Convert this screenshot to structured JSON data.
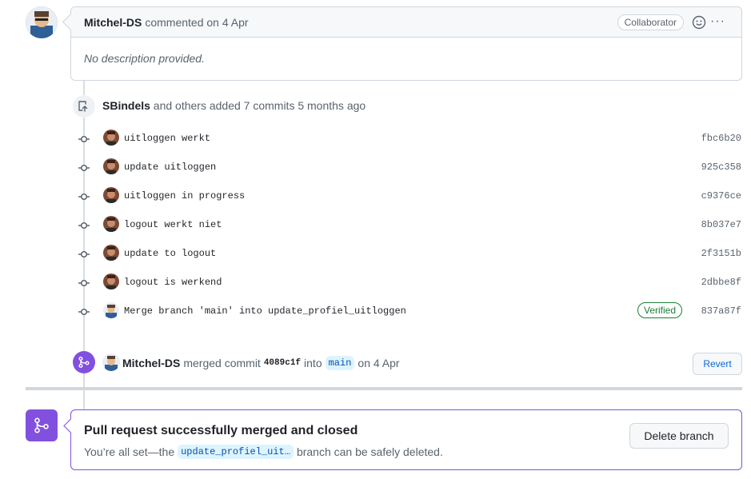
{
  "comment": {
    "author": "Mitchel-DS",
    "meta": "commented on 4 Apr",
    "badge": "Collaborator",
    "more": "···",
    "body": "No description provided."
  },
  "commits": {
    "header_author": "SBindels",
    "header_rest": "and others added 7 commits 5 months ago",
    "items": [
      {
        "message": "uitloggen werkt",
        "sha": "fbc6b20",
        "verified": ""
      },
      {
        "message": "update uitloggen",
        "sha": "925c358",
        "verified": ""
      },
      {
        "message": "uitloggen in progress",
        "sha": "c9376ce",
        "verified": ""
      },
      {
        "message": "logout werkt niet",
        "sha": "8b037e7",
        "verified": ""
      },
      {
        "message": "update to logout",
        "sha": "2f3151b",
        "verified": ""
      },
      {
        "message": "logout is werkend",
        "sha": "2dbbe8f",
        "verified": ""
      },
      {
        "message": "Merge branch 'main' into update_profiel_uitloggen",
        "sha": "837a87f",
        "verified": "Verified"
      }
    ]
  },
  "merge_event": {
    "author": "Mitchel-DS",
    "action": "merged commit",
    "sha": "4089c1f",
    "into": "into",
    "branch": "main",
    "date": "on 4 Apr",
    "revert_label": "Revert"
  },
  "merged_status": {
    "title": "Pull request successfully merged and closed",
    "desc_prefix": "You’re all set—the",
    "branch": "update_profiel_uit…",
    "desc_suffix": "branch can be safely deleted.",
    "delete_label": "Delete branch"
  },
  "colors": {
    "merged_purple": "#8250df",
    "verified_green": "#1a7f37",
    "link_blue": "#0969da"
  }
}
